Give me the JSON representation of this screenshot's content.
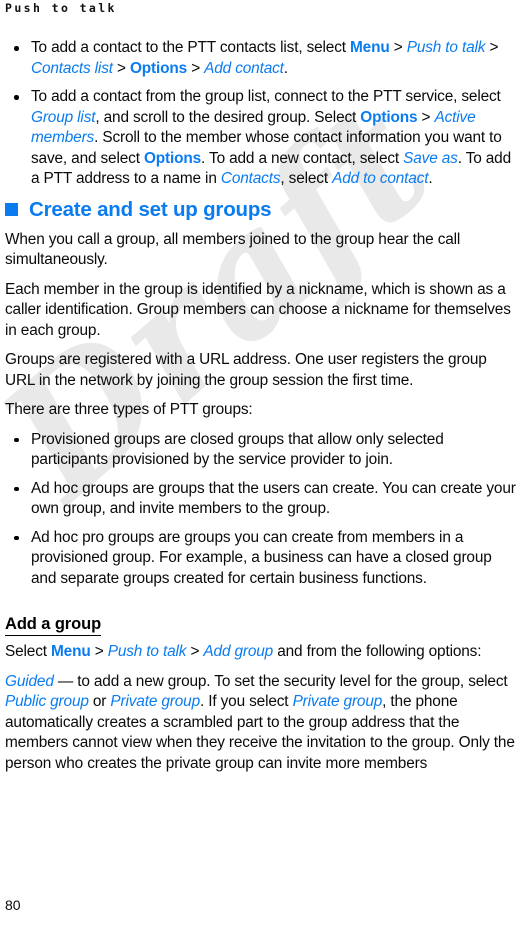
{
  "document": {
    "running_head": "Push to talk",
    "page_number": "80",
    "watermark": "Draft",
    "accent_color": "#0a7cf0",
    "watermark_color": "#e9e9e9",
    "text_color": "#0a0a0a"
  },
  "intro_bullets": [
    {
      "segments": [
        {
          "type": "plain",
          "text": "To add a contact to the PTT contacts list, select "
        },
        {
          "type": "ui",
          "text": "Menu"
        },
        {
          "type": "gt",
          "text": " > "
        },
        {
          "type": "it",
          "text": "Push to talk"
        },
        {
          "type": "gt",
          "text": " > "
        },
        {
          "type": "it",
          "text": "Contacts list"
        },
        {
          "type": "gt",
          "text": " > "
        },
        {
          "type": "ui",
          "text": "Options"
        },
        {
          "type": "gt",
          "text": " > "
        },
        {
          "type": "it",
          "text": "Add contact"
        },
        {
          "type": "plain",
          "text": "."
        }
      ]
    },
    {
      "segments": [
        {
          "type": "plain",
          "text": "To add a contact from the group list, connect to the PTT service, select "
        },
        {
          "type": "it",
          "text": "Group list"
        },
        {
          "type": "plain",
          "text": ", and scroll to the desired group. Select "
        },
        {
          "type": "ui",
          "text": "Options"
        },
        {
          "type": "gt",
          "text": " > "
        },
        {
          "type": "it",
          "text": "Active members"
        },
        {
          "type": "plain",
          "text": ". Scroll to the member whose contact information you want to save, and select "
        },
        {
          "type": "ui",
          "text": "Options"
        },
        {
          "type": "plain",
          "text": ". To add a new contact, select "
        },
        {
          "type": "it",
          "text": "Save as"
        },
        {
          "type": "plain",
          "text": ". To add a PTT address to a name in "
        },
        {
          "type": "it",
          "text": "Contacts"
        },
        {
          "type": "plain",
          "text": ", select "
        },
        {
          "type": "it",
          "text": "Add to contact"
        },
        {
          "type": "plain",
          "text": "."
        }
      ]
    }
  ],
  "section": {
    "heading": "Create and set up groups",
    "paragraphs": [
      "When you call a group, all members joined to the group hear the call simultaneously.",
      "Each member in the group is identified by a nickname, which is shown as a caller identification. Group members can choose a nickname for themselves in each group.",
      "Groups are registered with a URL address. One user registers the group URL in the network by joining the group session the first time.",
      "There are three types of PTT groups:"
    ],
    "group_type_bullets": [
      "Provisioned groups are closed groups that allow only selected participants provisioned by the service provider to join.",
      "Ad hoc groups are groups that the users can create. You can create your own group, and invite members to the group.",
      "Ad hoc pro groups are groups you can create from members in a provisioned group. For example, a business can have a closed group and separate groups created for certain business functions."
    ]
  },
  "subsection": {
    "heading": "Add a group",
    "intro": {
      "segments": [
        {
          "type": "plain",
          "text": "Select "
        },
        {
          "type": "ui",
          "text": "Menu"
        },
        {
          "type": "gt",
          "text": " > "
        },
        {
          "type": "it",
          "text": "Push to talk"
        },
        {
          "type": "gt",
          "text": " > "
        },
        {
          "type": "it",
          "text": "Add group"
        },
        {
          "type": "plain",
          "text": " and from the following options:"
        }
      ]
    },
    "options": [
      {
        "segments": [
          {
            "type": "it",
            "text": "Guided"
          },
          {
            "type": "plain",
            "text": " — to add a new group. To set the security level for the group, select "
          },
          {
            "type": "it",
            "text": "Public group"
          },
          {
            "type": "plain",
            "text": " or "
          },
          {
            "type": "it",
            "text": "Private group"
          },
          {
            "type": "plain",
            "text": ". If you select "
          },
          {
            "type": "it",
            "text": "Private group"
          },
          {
            "type": "plain",
            "text": ", the phone automatically creates a scrambled part to the group address that the members cannot view when they receive the invitation to the group. Only the person who creates the private group can invite more members"
          }
        ]
      }
    ]
  }
}
